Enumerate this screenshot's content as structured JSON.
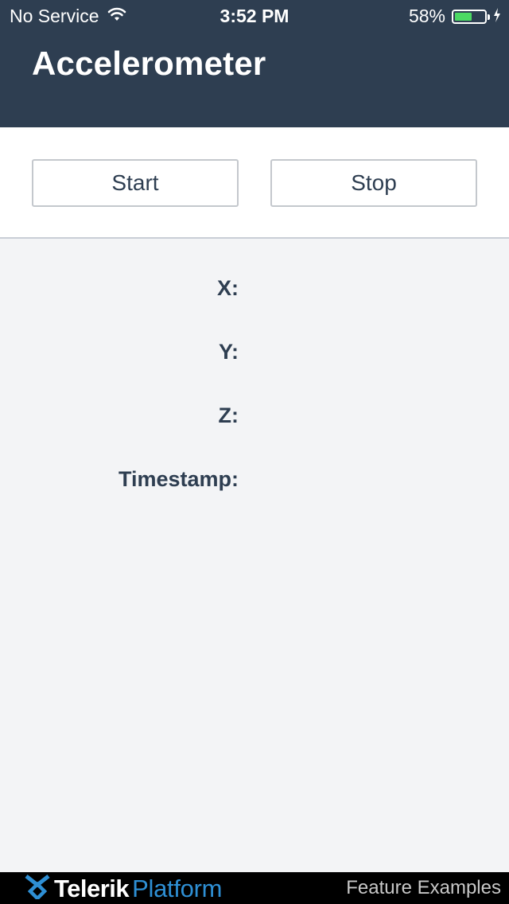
{
  "status_bar": {
    "carrier": "No Service",
    "time": "3:52 PM",
    "battery_percent": "58%",
    "battery_level": 0.58,
    "battery_color": "#4cd964",
    "icons": [
      "wifi-icon",
      "battery-icon",
      "charging-bolt-icon"
    ]
  },
  "header": {
    "title": "Accelerometer",
    "background_color": "#2e3e51"
  },
  "controls": {
    "start_label": "Start",
    "stop_label": "Stop"
  },
  "readings": [
    {
      "label": "X:",
      "value": ""
    },
    {
      "label": "Y:",
      "value": ""
    },
    {
      "label": "Z:",
      "value": ""
    },
    {
      "label": "Timestamp:",
      "value": ""
    }
  ],
  "footer": {
    "brand_name": "Telerik",
    "brand_product": "Platform",
    "caption": "Feature Examples",
    "brand_accent_color": "#2e8fd4",
    "icons": [
      "telerik-logo-icon"
    ]
  }
}
